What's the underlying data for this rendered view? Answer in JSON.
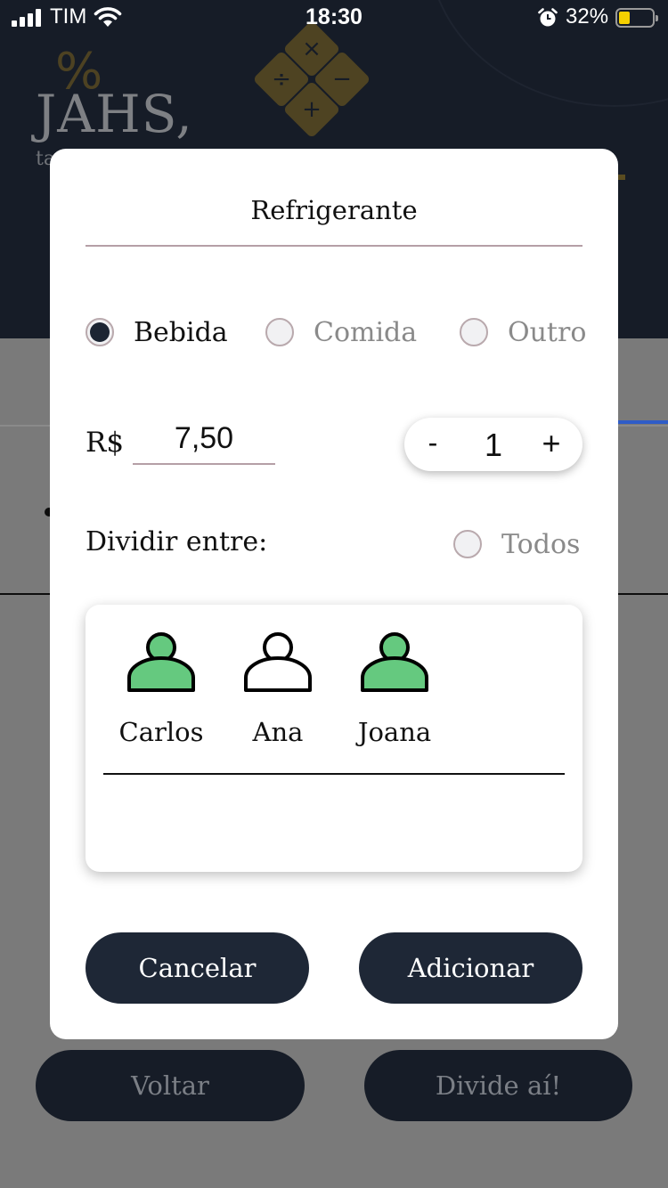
{
  "status_bar": {
    "carrier": "TIM",
    "time": "18:30",
    "battery_percent": "32%",
    "battery_level": 0.32
  },
  "background": {
    "title": "JAHS,",
    "subtitle": "ta",
    "percent_glyph": "%",
    "logo_symbols": [
      "×",
      "÷",
      "−",
      "+"
    ],
    "back_button": "Voltar",
    "divide_button": "Divide aí!"
  },
  "modal": {
    "item_name": "Refrigerante",
    "categories": [
      {
        "label": "Bebida",
        "selected": true
      },
      {
        "label": "Comida",
        "selected": false
      },
      {
        "label": "Outro",
        "selected": false
      }
    ],
    "currency": "R$",
    "price": "7,50",
    "quantity": {
      "minus": "-",
      "value": "1",
      "plus": "+"
    },
    "split_label": "Dividir entre:",
    "all_label": "Todos",
    "all_selected": false,
    "people": [
      {
        "name": "Carlos",
        "selected": true
      },
      {
        "name": "Ana",
        "selected": false
      },
      {
        "name": "Joana",
        "selected": true
      }
    ],
    "cancel_button": "Cancelar",
    "add_button": "Adicionar"
  },
  "colors": {
    "selected_person": "#65c97f",
    "button_dark": "#1e2736",
    "header_dark": "#161c27",
    "battery_yellow": "#f5d000"
  }
}
